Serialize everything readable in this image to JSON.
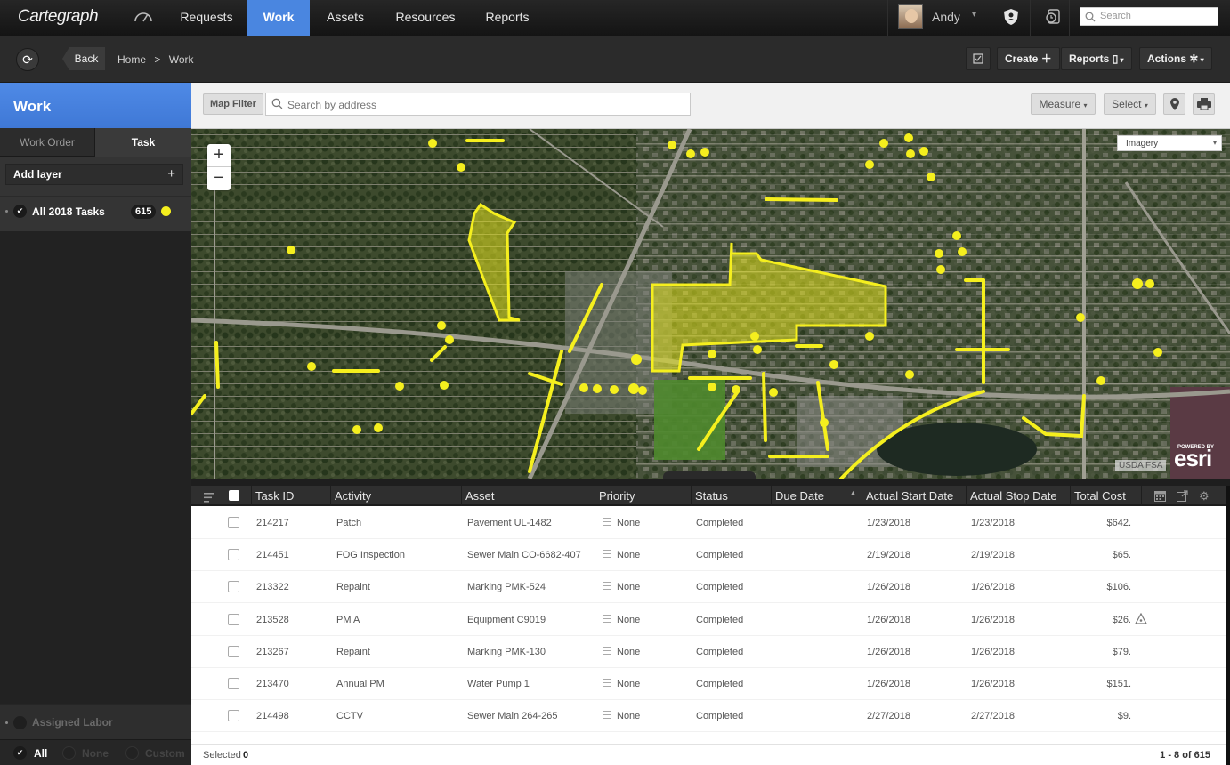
{
  "app": {
    "logo": "Cartegraph"
  },
  "topnav": {
    "items": [
      {
        "label": "Requests"
      },
      {
        "label": "Work",
        "active": true
      },
      {
        "label": "Assets"
      },
      {
        "label": "Resources"
      },
      {
        "label": "Reports"
      }
    ],
    "user": "Andy",
    "search_placeholder": "Search",
    "accent": "#4a86e0"
  },
  "subbar": {
    "back": "Back",
    "breadcrumb": [
      "Home",
      ">",
      "Work"
    ],
    "create": "Create",
    "reports": "Reports",
    "actions": "Actions"
  },
  "sidebar": {
    "title": "Work",
    "tabs": [
      {
        "label": "Work Order"
      },
      {
        "label": "Task",
        "active": true
      }
    ],
    "add_layer": "Add layer",
    "layers": [
      {
        "label": "All 2018 Tasks",
        "count": "615",
        "color": "#f5ef1e"
      }
    ],
    "filter_group": "Assigned Labor",
    "filter_options": [
      "All",
      "None",
      "Custom"
    ],
    "filter_selected": "All"
  },
  "map": {
    "filter_button": "Map Filter",
    "address_placeholder": "Search by address",
    "measure": "Measure",
    "select": "Select",
    "basemap": "Imagery",
    "attribution": "USDA FSA",
    "powered_by": "POWERED BY",
    "esri": "esri",
    "zoom_in": "+",
    "zoom_out": "−"
  },
  "grid": {
    "columns": [
      "Task ID",
      "Activity",
      "Asset",
      "Priority",
      "Status",
      "Due Date",
      "Actual Start Date",
      "Actual Stop Date",
      "Total Cost"
    ],
    "sorted_column": "Due Date",
    "rows": [
      {
        "id": "214217",
        "activity": "Patch",
        "asset": "Pavement UL-1482",
        "priority": "None",
        "status": "Completed",
        "due": "",
        "start": "1/23/2018",
        "stop": "1/23/2018",
        "cost": "$642.",
        "warning": false
      },
      {
        "id": "214451",
        "activity": "FOG Inspection",
        "asset": "Sewer Main CO-6682-407",
        "priority": "None",
        "status": "Completed",
        "due": "",
        "start": "2/19/2018",
        "stop": "2/19/2018",
        "cost": "$65.",
        "warning": false
      },
      {
        "id": "213322",
        "activity": "Repaint",
        "asset": "Marking PMK-524",
        "priority": "None",
        "status": "Completed",
        "due": "",
        "start": "1/26/2018",
        "stop": "1/26/2018",
        "cost": "$106.",
        "warning": false
      },
      {
        "id": "213528",
        "activity": "PM A",
        "asset": "Equipment C9019",
        "priority": "None",
        "status": "Completed",
        "due": "",
        "start": "1/26/2018",
        "stop": "1/26/2018",
        "cost": "$26.",
        "warning": true
      },
      {
        "id": "213267",
        "activity": "Repaint",
        "asset": "Marking PMK-130",
        "priority": "None",
        "status": "Completed",
        "due": "",
        "start": "1/26/2018",
        "stop": "1/26/2018",
        "cost": "$79.",
        "warning": false
      },
      {
        "id": "213470",
        "activity": "Annual PM",
        "asset": "Water Pump 1",
        "priority": "None",
        "status": "Completed",
        "due": "",
        "start": "1/26/2018",
        "stop": "1/26/2018",
        "cost": "$151.",
        "warning": false
      },
      {
        "id": "214498",
        "activity": "CCTV",
        "asset": "Sewer Main 264-265",
        "priority": "None",
        "status": "Completed",
        "due": "",
        "start": "2/27/2018",
        "stop": "2/27/2018",
        "cost": "$9.",
        "warning": false
      }
    ],
    "selected_label": "Selected",
    "selected_count": "0",
    "pagination": "1 - 8 of 615"
  }
}
